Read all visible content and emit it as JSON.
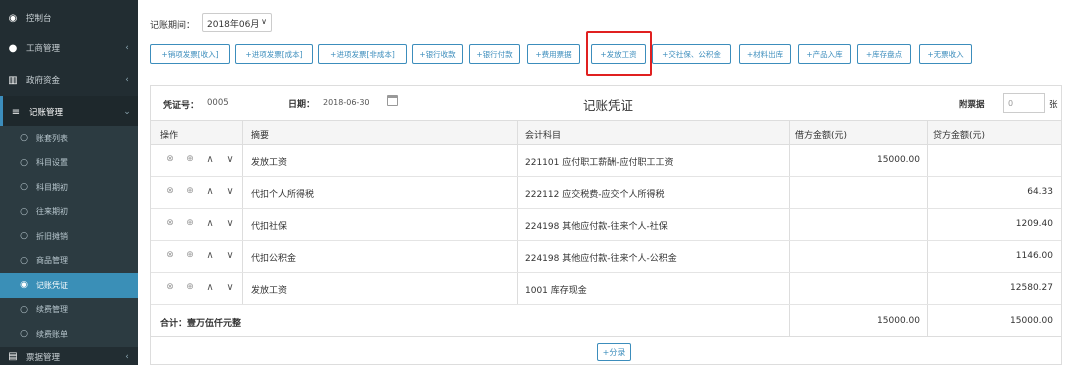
{
  "sidebar": {
    "items": [
      {
        "label": "控制台",
        "icon": "dashboard-icon",
        "glyph": "◉",
        "chevron": ""
      },
      {
        "label": "工商管理",
        "icon": "business-icon",
        "glyph": "●",
        "chevron": "‹"
      },
      {
        "label": "政府资金",
        "icon": "bank-icon",
        "glyph": "▥",
        "chevron": "‹"
      },
      {
        "label": "记账管理",
        "icon": "list-icon",
        "glyph": "≡",
        "chevron": "⌄"
      }
    ],
    "sub_items": [
      {
        "label": "账套列表",
        "active": false
      },
      {
        "label": "科目设置",
        "active": false
      },
      {
        "label": "科目期初",
        "active": false
      },
      {
        "label": "往来期初",
        "active": false
      },
      {
        "label": "折旧摊销",
        "active": false
      },
      {
        "label": "商品管理",
        "active": false
      },
      {
        "label": "记账凭证",
        "active": true
      },
      {
        "label": "续费管理",
        "active": false
      },
      {
        "label": "续费账单",
        "active": false
      }
    ],
    "bottom_item": {
      "label": "票据管理",
      "icon": "ticket-icon",
      "glyph": "▤",
      "chevron": "‹"
    }
  },
  "period": {
    "label": "记账期间：",
    "value": "2018年06月"
  },
  "quick_buttons": [
    "+销项发票[收入]",
    "+进项发票[成本]",
    "+进项发票[非成本]",
    "+银行收款",
    "+银行付款",
    "+费用票据",
    "+发放工资",
    "+交社保、公积金",
    "+材料出库",
    "+产品入库",
    "+库存盘点",
    "+无票收入"
  ],
  "voucher": {
    "no_label": "凭证号：",
    "no_value": "0005",
    "date_label": "日期：",
    "date_value": "2018-06-30",
    "title": "记账凭证",
    "attach_label": "附票据",
    "attach_value": "0",
    "attach_unit": "张",
    "columns": {
      "ops": "操作",
      "summary": "摘要",
      "account": "会计科目",
      "debit": "借方金额(元)",
      "credit": "贷方金额(元)"
    },
    "rows": [
      {
        "summary": "发放工资",
        "account": "221101 应付职工薪酬-应付职工工资",
        "debit": "15000.00",
        "credit": ""
      },
      {
        "summary": "代扣个人所得税",
        "account": "222112 应交税费-应交个人所得税",
        "debit": "",
        "credit": "64.33"
      },
      {
        "summary": "代扣社保",
        "account": "224198 其他应付款-往来个人-社保",
        "debit": "",
        "credit": "1209.40"
      },
      {
        "summary": "代扣公积金",
        "account": "224198 其他应付款-往来个人-公积金",
        "debit": "",
        "credit": "1146.00"
      },
      {
        "summary": "发放工资",
        "account": "1001 库存现金",
        "debit": "",
        "credit": "12580.27"
      }
    ],
    "total": {
      "label": "合计：壹万伍仟元整",
      "debit": "15000.00",
      "credit": "15000.00"
    },
    "add_entry_label": "+分录"
  },
  "colors": {
    "sidebar_bg": "#222d32",
    "accent": "#3c8dbc",
    "highlight": "#e02020"
  }
}
